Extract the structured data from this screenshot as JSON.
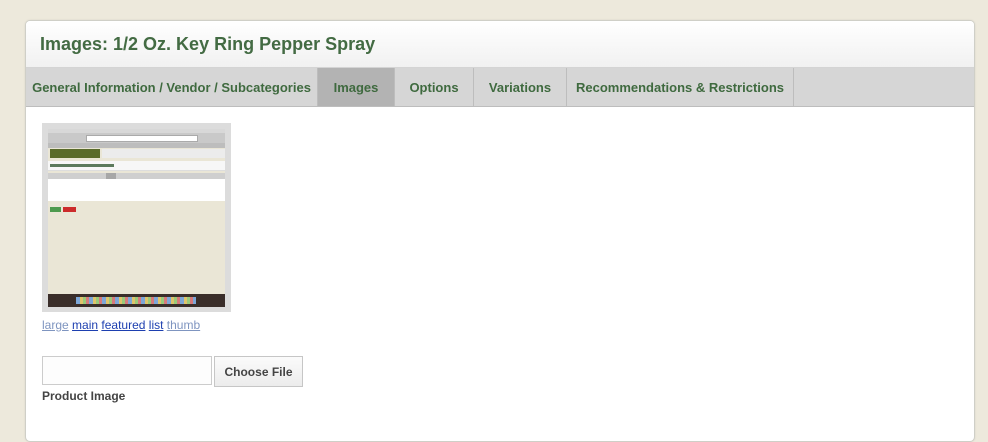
{
  "page": {
    "title": "Images: 1/2 Oz. Key Ring Pepper Spray"
  },
  "tabs": [
    {
      "label": "General Information / Vendor / Subcategories",
      "active": false
    },
    {
      "label": "Images",
      "active": true
    },
    {
      "label": "Options",
      "active": false
    },
    {
      "label": "Variations",
      "active": false
    },
    {
      "label": "Recommendations & Restrictions",
      "active": false
    }
  ],
  "image_sizes": {
    "large": "large",
    "main": "main",
    "featured": "featured",
    "list": "list",
    "thumb": "thumb"
  },
  "upload": {
    "button_label": "Choose File",
    "field_label": "Product Image"
  },
  "colors": {
    "title": "#436b43",
    "tab_text": "#3f6a3f",
    "tab_active_bg": "#b3b3b3",
    "link": "#1d3fb0"
  }
}
